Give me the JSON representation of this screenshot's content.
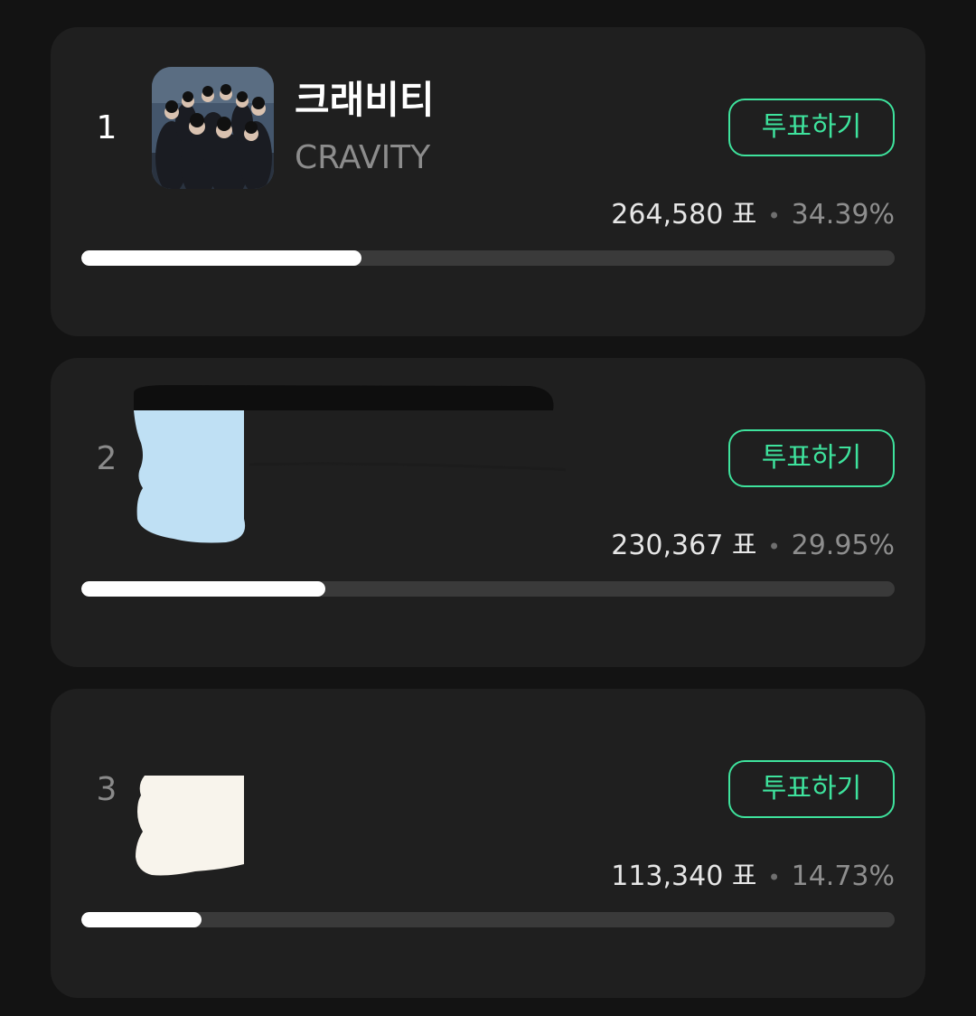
{
  "candidates": [
    {
      "rank": "1",
      "name_ko": "크래비티",
      "name_en": "CRAVITY",
      "vote_label": "투표하기",
      "votes": "264,580 표",
      "percent": "34.39%",
      "share": 0.3439
    },
    {
      "rank": "2",
      "vote_label": "투표하기",
      "votes": "230,367 표",
      "percent": "29.95%",
      "share": 0.2995
    },
    {
      "rank": "3",
      "vote_label": "투표하기",
      "votes": "113,340 표",
      "percent": "14.73%",
      "share": 0.1473
    }
  ],
  "separator": "•",
  "colors": {
    "background": "#131313",
    "card": "#1f1f1f",
    "accent": "#3ee39d",
    "bar_track": "#3a3a3a",
    "bar_fill": "#ffffff"
  }
}
